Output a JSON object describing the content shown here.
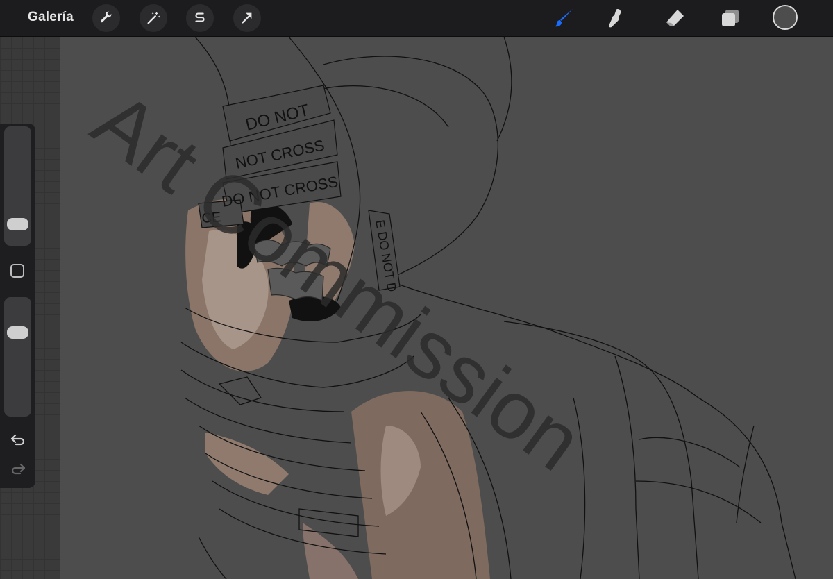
{
  "header": {
    "gallery_label": "Galería",
    "left_tools": [
      {
        "name": "actions",
        "icon": "wrench-icon"
      },
      {
        "name": "adjustments",
        "icon": "magic-wand-icon"
      },
      {
        "name": "selection",
        "icon": "selection-s-icon"
      },
      {
        "name": "transform",
        "icon": "arrow-cursor-icon"
      }
    ],
    "right_tools": [
      {
        "name": "brush",
        "icon": "brush-icon",
        "active": true
      },
      {
        "name": "smudge",
        "icon": "smudge-finger-icon",
        "active": false
      },
      {
        "name": "eraser",
        "icon": "eraser-icon",
        "active": false
      },
      {
        "name": "layers",
        "icon": "layers-icon",
        "active": false
      }
    ],
    "current_color": "#4d4d4d",
    "accent_color": "#1a6cff"
  },
  "sidebar": {
    "brush_size": 0.12,
    "brush_opacity": 0.74,
    "modify_icon": "square-icon",
    "undo_icon": "undo-arrow-icon",
    "redo_icon": "redo-arrow-icon"
  },
  "canvas": {
    "watermark": "Art Commission",
    "tape_text": [
      "DO NOT",
      "NOT CROSS",
      "DO NOT CROSS",
      "CE",
      "E DO NOT D"
    ],
    "background_color": "#4d4d4d"
  }
}
